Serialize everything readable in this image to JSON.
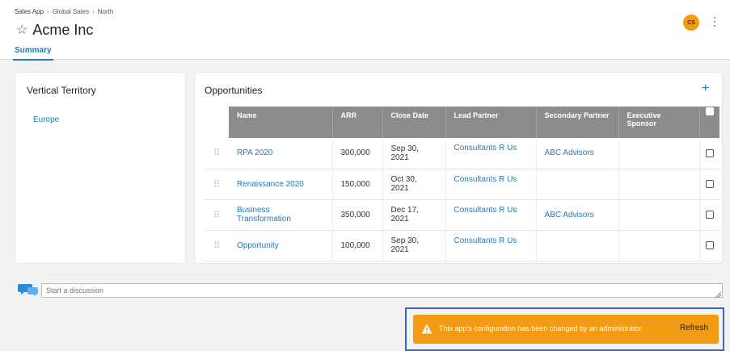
{
  "header": {
    "breadcrumb": [
      "Sales App",
      "Global Sales",
      "North"
    ],
    "breadcrumb_sep": "›",
    "title": "Acme Inc",
    "star_icon": "star-outline-icon",
    "tab": "Summary",
    "avatar_initials": "CS",
    "avatar_color": "#f39b12",
    "menu_icon": "kebab-menu-icon"
  },
  "vertical_territory": {
    "title": "Vertical Territory",
    "link": "Europe"
  },
  "opportunities": {
    "title": "Opportunities",
    "add_icon": "plus-icon",
    "columns": [
      "Name",
      "ARR",
      "Close Date",
      "Lead Partner",
      "Secondary Partner",
      "Executive Sponsor"
    ],
    "rows": [
      {
        "name": "RPA 2020",
        "arr": "300,000",
        "close_date": "Sep 30, 2021",
        "lead_partner": "Consultants R Us",
        "secondary_partner": "ABC Advisors",
        "executive_sponsor": ""
      },
      {
        "name": "Renaissance 2020",
        "arr": "150,000",
        "close_date": "Oct 30, 2021",
        "lead_partner": "Consultants R Us",
        "secondary_partner": "",
        "executive_sponsor": ""
      },
      {
        "name": "Business Transformation",
        "arr": "350,000",
        "close_date": "Dec 17, 2021",
        "lead_partner": "Consultants R Us",
        "secondary_partner": "ABC Advisors",
        "executive_sponsor": ""
      },
      {
        "name": "Opportunity",
        "arr": "100,000",
        "close_date": "Sep 30, 2021",
        "lead_partner": "Consultants R Us",
        "secondary_partner": "",
        "executive_sponsor": ""
      }
    ]
  },
  "discussion": {
    "placeholder": "Start a discussion",
    "icon": "chat-bubbles-icon"
  },
  "toast": {
    "message": "This app's configuration has been changed by an administrator.",
    "action": "Refresh",
    "icon": "warning-icon",
    "color": "#f39b12"
  },
  "colors": {
    "accent": "#1f7ab8",
    "table_header": "#8c8c8c",
    "highlight_frame": "#3b68c4"
  }
}
